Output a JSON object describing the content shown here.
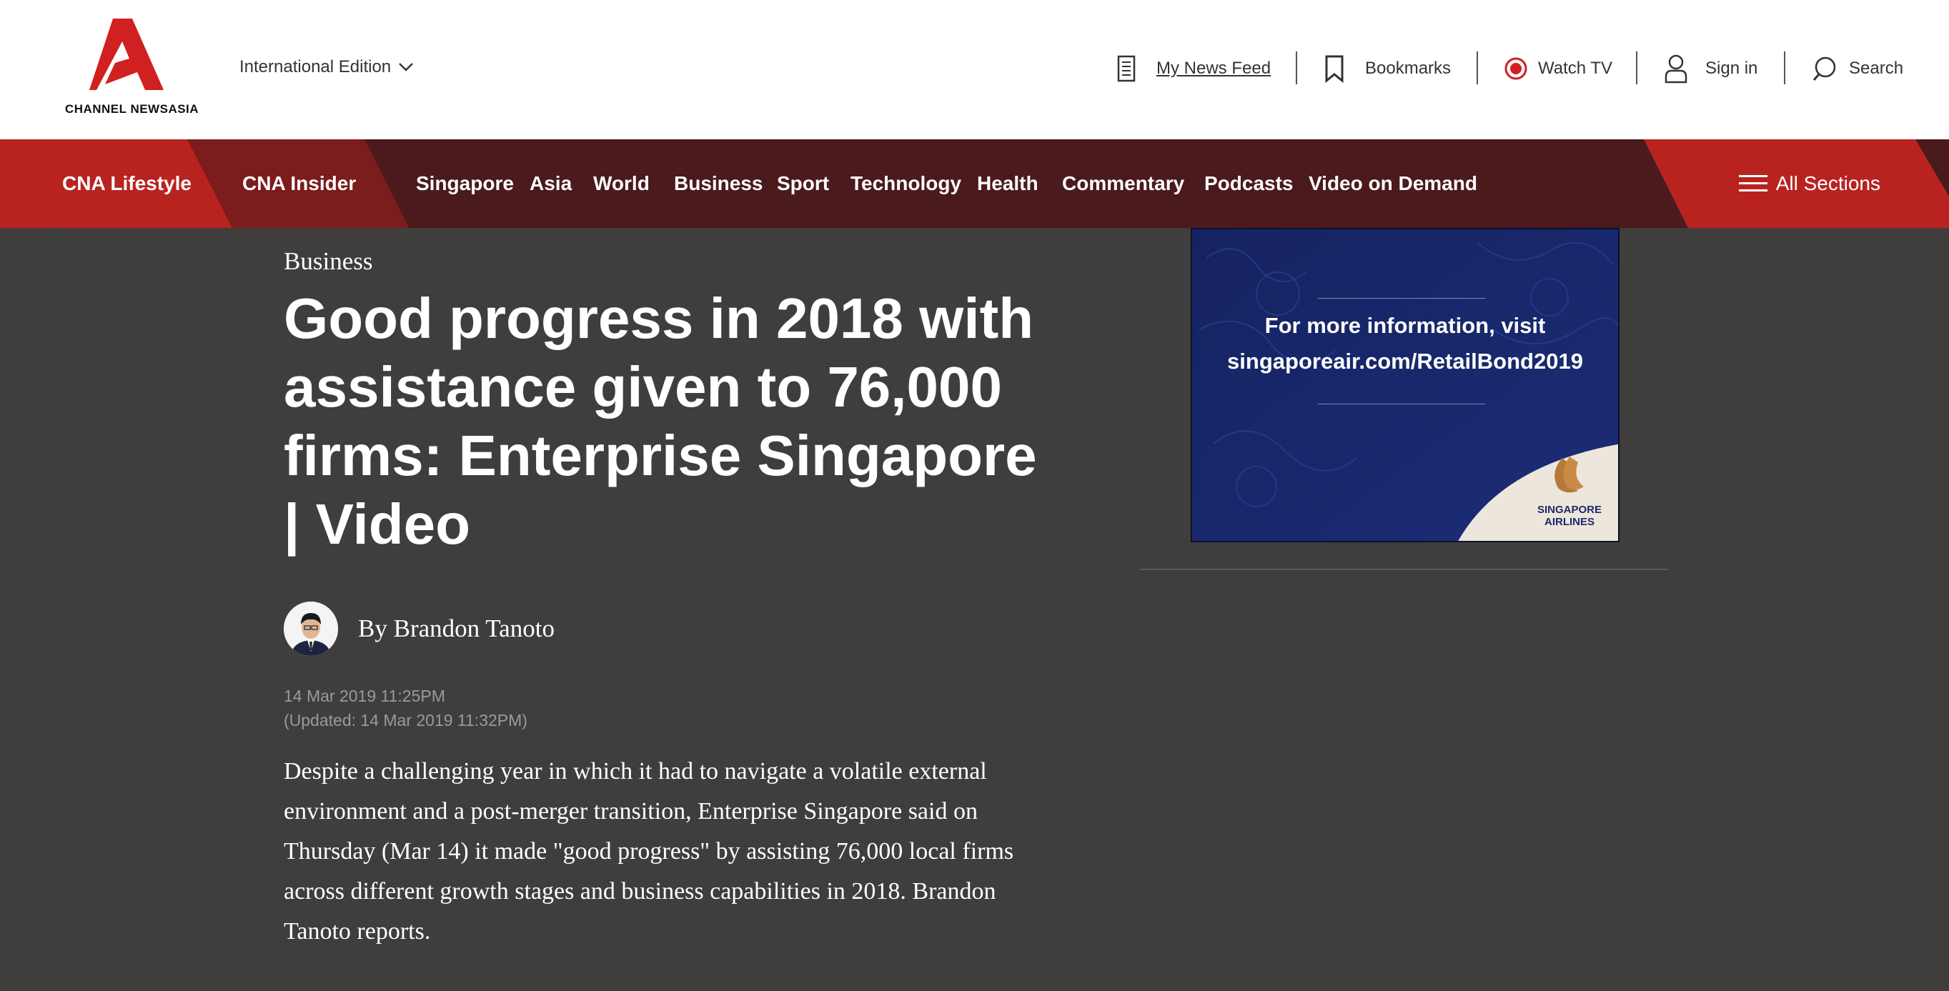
{
  "brand": {
    "logo_text": "CHANNEL NEWSASIA",
    "accent": "#d0201f"
  },
  "header": {
    "edition": "International Edition",
    "utility": {
      "news_feed": "My News Feed",
      "bookmarks": "Bookmarks",
      "watch_tv": "Watch TV",
      "sign_in": "Sign in",
      "search": "Search"
    }
  },
  "nav": {
    "featured": [
      "CNA Lifestyle",
      "CNA Insider"
    ],
    "items": [
      "Singapore",
      "Asia",
      "World",
      "Business",
      "Sport",
      "Technology",
      "Health",
      "Commentary",
      "Podcasts",
      "Video on Demand"
    ],
    "all_sections": "All Sections"
  },
  "article": {
    "section": "Business",
    "headline": "Good progress in 2018 with assistance given to 76,000 firms: Enterprise Singapore | Video",
    "byline": "By Brandon Tanoto",
    "published": "14 Mar 2019 11:25PM",
    "updated": "(Updated: 14 Mar 2019 11:32PM)",
    "summary": "Despite a challenging year in which it had to navigate a volatile external environment and a post-merger transition, Enterprise Singapore said on Thursday (Mar 14) it made \"good progress\" by assisting 76,000 local firms across different growth stages and business capabilities in 2018. Brandon Tanoto reports."
  },
  "ad": {
    "line1": "For more information, visit",
    "line2": "singaporeair.com/RetailBond2019",
    "logo_text_1": "SINGAPORE",
    "logo_text_2": "AIRLINES"
  }
}
